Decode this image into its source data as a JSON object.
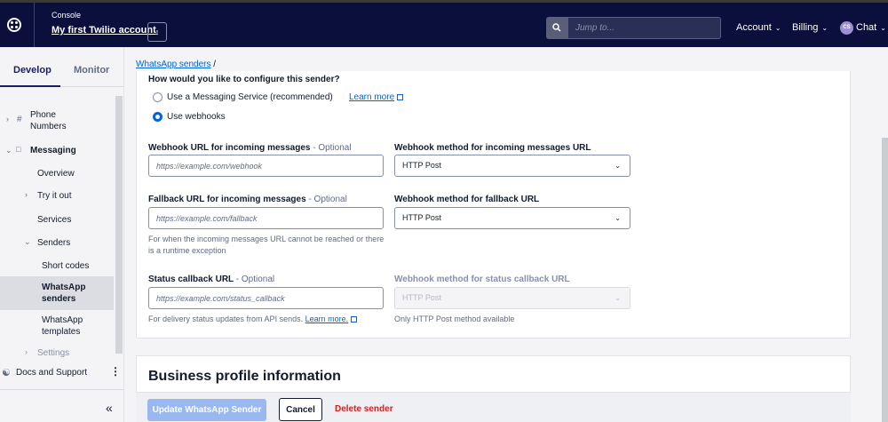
{
  "topbar": {
    "console_label": "Console",
    "account_name": "My first Twilio account",
    "account_switch_icon": "chevron-up-down",
    "search_placeholder": "Jump to...",
    "account_menu": "Account",
    "billing_menu": "Billing",
    "avatar_initials": "CS",
    "chat_menu": "Chat"
  },
  "sidebar": {
    "tabs": [
      "Develop",
      "Monitor"
    ],
    "items": {
      "phone_numbers": "Phone Numbers",
      "messaging": "Messaging",
      "overview": "Overview",
      "try_it_out": "Try it out",
      "services": "Services",
      "senders": "Senders",
      "short_codes": "Short codes",
      "whatsapp_senders": "WhatsApp senders",
      "whatsapp_templates": "WhatsApp templates",
      "settings": "Settings",
      "docs_support": "Docs and Support"
    },
    "collapse_glyph": "«"
  },
  "breadcrumb": {
    "link": "WhatsApp senders",
    "separator": "/"
  },
  "configure": {
    "question": "How would you like to configure this sender?",
    "option_messaging_service": "Use a Messaging Service (recommended)",
    "learn_more": "Learn more",
    "option_webhooks": "Use webhooks"
  },
  "fields": {
    "incoming_label": "Webhook URL for incoming messages",
    "optional": "- Optional",
    "incoming_placeholder": "https://example.com/webhook",
    "incoming_method_label": "Webhook method for incoming messages URL",
    "incoming_method_value": "HTTP Post",
    "fallback_label": "Fallback URL for incoming messages",
    "fallback_placeholder": "https://example.com/fallback",
    "fallback_method_label": "Webhook method for fallback URL",
    "fallback_method_value": "HTTP Post",
    "fallback_help": "For when the incoming messages URL cannot be reached or there is a runtime exception",
    "status_label": "Status callback URL",
    "status_placeholder": "https://example.com/status_callback",
    "status_method_label": "Webhook method for status callback URL",
    "status_method_value": "HTTP Post",
    "status_help": "For delivery status updates from API sends.",
    "status_learn_more": "Learn more.",
    "status_method_help": "Only HTTP Post method available"
  },
  "business": {
    "title": "Business profile information"
  },
  "actions": {
    "update": "Update WhatsApp Sender",
    "cancel": "Cancel",
    "delete": "Delete sender"
  },
  "colors": {
    "topbar": "#0b0f3b",
    "link": "#0263e0",
    "primary_disabled": "#99b8f0",
    "danger": "#d61f1f"
  }
}
